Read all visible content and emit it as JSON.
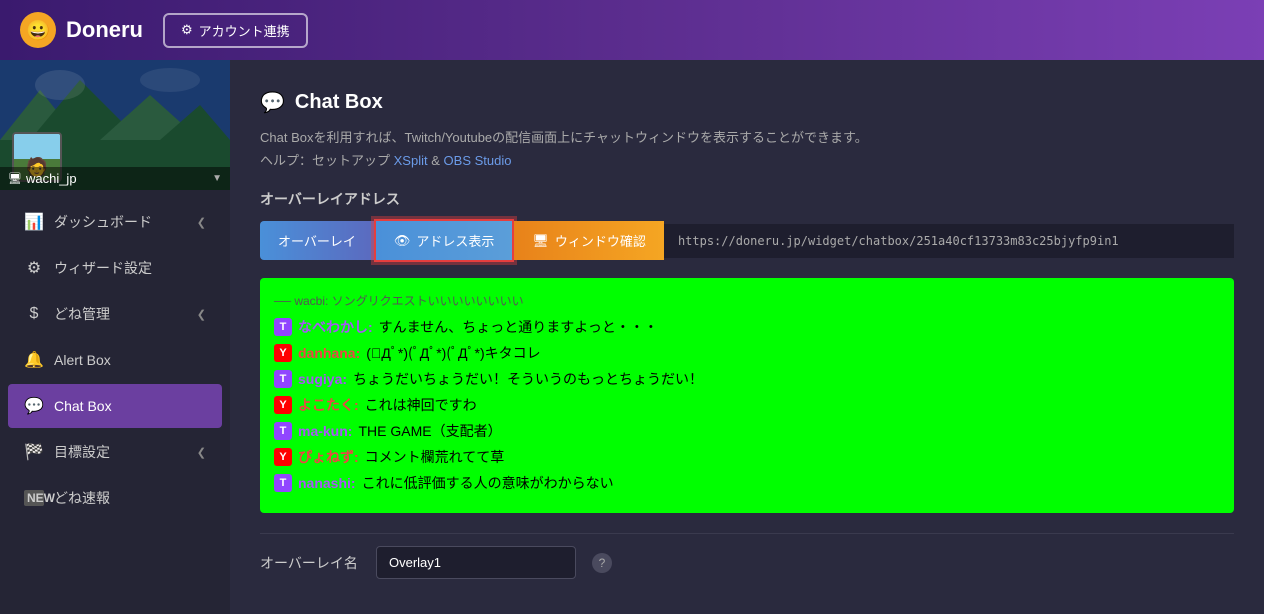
{
  "header": {
    "logo_text": "Doneru",
    "account_link_label": "アカウント連携",
    "logo_emoji": "😀"
  },
  "sidebar": {
    "user": {
      "name": "wachi_jp",
      "icon": "🖥"
    },
    "items": [
      {
        "id": "dashboard",
        "label": "ダッシュボード",
        "icon": "📊",
        "has_arrow": true
      },
      {
        "id": "wizard",
        "label": "ウィザード設定",
        "icon": "⚙",
        "has_arrow": false
      },
      {
        "id": "done",
        "label": "どね管理",
        "icon": "$",
        "has_arrow": true
      },
      {
        "id": "alertbox",
        "label": "Alert Box",
        "icon": "🔔",
        "has_arrow": false
      },
      {
        "id": "chatbox",
        "label": "Chat Box",
        "icon": "💬",
        "active": true,
        "has_arrow": false
      },
      {
        "id": "goals",
        "label": "目標設定",
        "icon": "🏁",
        "has_arrow": true
      },
      {
        "id": "done-news",
        "label": "どね速報",
        "icon": "📰",
        "has_arrow": false
      }
    ]
  },
  "main": {
    "page_title": "Chat Box",
    "page_title_icon": "💬",
    "description1": "Chat Boxを利用すれば、Twitch/Youtubeの配信画面上にチャットウィンドウを表示することができます。",
    "description2": "ヘルプ：セットアップ",
    "link_xsplit": "XSplit",
    "link_separator": " & ",
    "link_obs": "OBS Studio",
    "section_label": "オーバーレイアドレス",
    "btn_overlay": "オーバーレイ",
    "btn_address": "アドレス表示",
    "btn_address_icon": "👁",
    "btn_window": "ウィンドウ確認",
    "btn_window_icon": "🖥",
    "address_url": "https://doneru.jp/widget/chatbox/251a40cf13733m83c25bjyfp9in1",
    "chat_top_bar": "── wacbi: ソングリクエストいいいいいいいい",
    "chat_messages": [
      {
        "platform": "twitch",
        "username": "なべわかし",
        "message": "すんません、ちょっと通りますよっと・・・"
      },
      {
        "platform": "youtube",
        "username": "danhana",
        "message": "(ﾟДﾟ*)(ﾟДﾟ*)(ﾟДﾟ*)キタコレ"
      },
      {
        "platform": "twitch",
        "username": "sugiya",
        "message": "ちょうだいちょうだい！そういうのもっとちょうだい！"
      },
      {
        "platform": "youtube",
        "username": "よこたく",
        "message": "これは神回ですわ"
      },
      {
        "platform": "twitch",
        "username": "ma-kun",
        "message": "THE GAME（支配者）"
      },
      {
        "platform": "youtube",
        "username": "ぴょねず",
        "message": "コメント欄荒れてて草"
      },
      {
        "platform": "twitch",
        "username": "nanashi",
        "message": "これに低評価する人の意味がわからない"
      }
    ],
    "overlay_name_label": "オーバーレイ名",
    "overlay_name_value": "Overlay1"
  }
}
